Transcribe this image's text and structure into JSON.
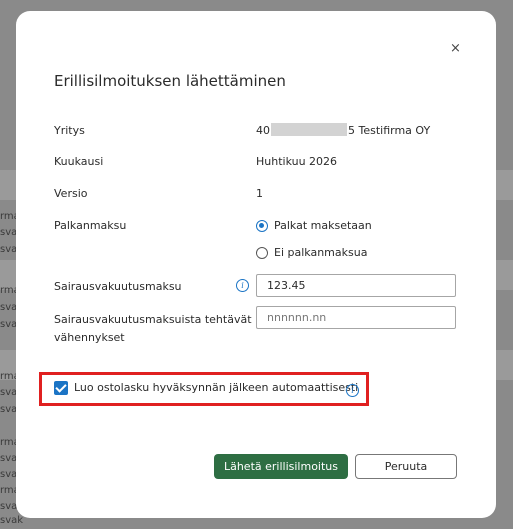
{
  "background": {
    "rows": [
      "rma",
      "svak",
      "svak",
      "rma",
      "svak",
      "svak",
      "rma",
      "svak",
      "svak",
      "rma",
      "svak",
      "svak",
      "rma",
      "svak",
      "svak"
    ]
  },
  "dialog": {
    "title": "Erillisilmoituksen lähettäminen",
    "close_icon": "×",
    "company": {
      "label": "Yritys",
      "value_prefix": "40",
      "value_suffix": "5 Testifirma OY"
    },
    "month": {
      "label": "Kuukausi",
      "value": "Huhtikuu 2026"
    },
    "version": {
      "label": "Versio",
      "value": "1"
    },
    "payment": {
      "label": "Palkanmaksu",
      "options": [
        {
          "label": "Palkat maksetaan",
          "selected": true
        },
        {
          "label": "Ei palkanmaksua",
          "selected": false
        }
      ]
    },
    "sickness_fee": {
      "label": "Sairausvakuutusmaksu",
      "value": "123.45",
      "info_icon": "i"
    },
    "deductions": {
      "label_line1": "Sairausvakuutusmaksuista tehtävät",
      "label_line2": "vähennykset",
      "placeholder": "nnnnnn.nn"
    },
    "auto_invoice": {
      "label": "Luo ostolasku hyväksynnän jälkeen automaattisesti",
      "checked": true,
      "info_icon": "i"
    },
    "buttons": {
      "submit": "Lähetä erillisilmoitus",
      "cancel": "Peruuta"
    }
  },
  "colors": {
    "accent": "#1b74c5",
    "primary_button": "#2e6e43",
    "highlight": "#e02020"
  }
}
